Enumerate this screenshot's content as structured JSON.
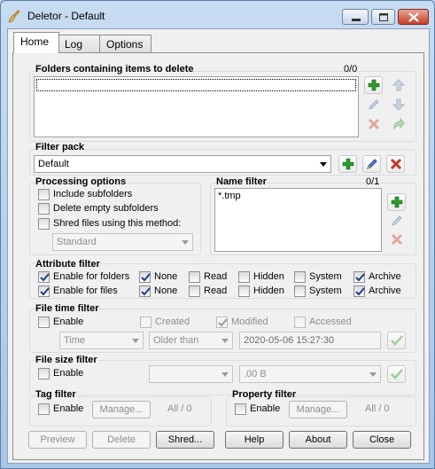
{
  "window": {
    "title": "Deletor - Default",
    "icons": [
      "broom-icon",
      "minimize-icon",
      "maximize-icon",
      "close-icon"
    ]
  },
  "tabs": [
    {
      "label": "Home",
      "active": true
    },
    {
      "label": "Log",
      "active": false
    },
    {
      "label": "Options",
      "active": false
    }
  ],
  "folders": {
    "title": "Folders containing items to delete",
    "count": "0/0"
  },
  "filter_pack": {
    "title": "Filter pack",
    "selected": "Default"
  },
  "processing": {
    "title": "Processing options",
    "include_subfolders": "Include subfolders",
    "delete_empty": "Delete empty subfolders",
    "shred": "Shred files using this method:",
    "method": "Standard"
  },
  "name_filter": {
    "title": "Name filter",
    "count": "0/1",
    "items": [
      "*.tmp"
    ]
  },
  "attribute_filter": {
    "title": "Attribute filter",
    "enable_folders": "Enable for folders",
    "enable_files": "Enable for files",
    "attrs": [
      "None",
      "Read",
      "Hidden",
      "System",
      "Archive"
    ],
    "folder_checked": [
      true,
      false,
      false,
      false,
      true
    ],
    "file_checked": [
      true,
      false,
      false,
      false,
      true
    ]
  },
  "file_time_filter": {
    "title": "File time filter",
    "enable": "Enable",
    "created": "Created",
    "modified": "Modified",
    "accessed": "Accessed",
    "unit": "Time",
    "compare": "Older than",
    "datetime": "2020-05-06 15:27:30"
  },
  "file_size_filter": {
    "title": "File size filter",
    "enable": "Enable",
    "size_value": ".00 B"
  },
  "tag_filter": {
    "title": "Tag filter",
    "enable": "Enable",
    "manage": "Manage...",
    "count": "All / 0"
  },
  "property_filter": {
    "title": "Property filter",
    "enable": "Enable",
    "manage": "Manage...",
    "count": "All / 0"
  },
  "footer": {
    "preview": "Preview",
    "delete": "Delete",
    "shred": "Shred...",
    "help": "Help",
    "about": "About",
    "close": "Close"
  },
  "colors": {
    "add_green": "#2e9a2e",
    "remove_red": "#c0392b",
    "edit_blue": "#3b6fb6"
  }
}
